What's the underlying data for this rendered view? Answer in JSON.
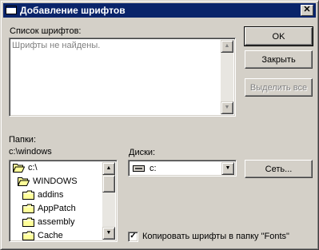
{
  "window": {
    "title": "Добавление шрифтов",
    "close_glyph": "✕"
  },
  "fonts_list": {
    "label": "Список шрифтов:",
    "placeholder": "Шрифты не найдены."
  },
  "folders": {
    "label": "Папки:",
    "current_path": "c:\\windows",
    "tree": [
      {
        "name": "c:\\",
        "icon": "open-folder-icon"
      },
      {
        "name": "WINDOWS",
        "icon": "open-folder-icon"
      },
      {
        "name": "addins",
        "icon": "folder-icon"
      },
      {
        "name": "AppPatch",
        "icon": "folder-icon"
      },
      {
        "name": "assembly",
        "icon": "folder-icon"
      },
      {
        "name": "Cache",
        "icon": "folder-icon"
      }
    ]
  },
  "drives": {
    "label": "Диски:",
    "selected": "c:",
    "icon": "drive-icon"
  },
  "buttons": {
    "ok": "OK",
    "close": "Закрыть",
    "select_all": "Выделить все",
    "network": "Сеть..."
  },
  "copy_option": {
    "label": "Копировать шрифты в папку \"Fonts\"",
    "checked": true,
    "check_glyph": "✓"
  },
  "scroll_glyphs": {
    "up": "▲",
    "down": "▼"
  },
  "colors": {
    "title_bar": "#0a246a",
    "face": "#d4d0c8",
    "folder": "#ffff99"
  }
}
